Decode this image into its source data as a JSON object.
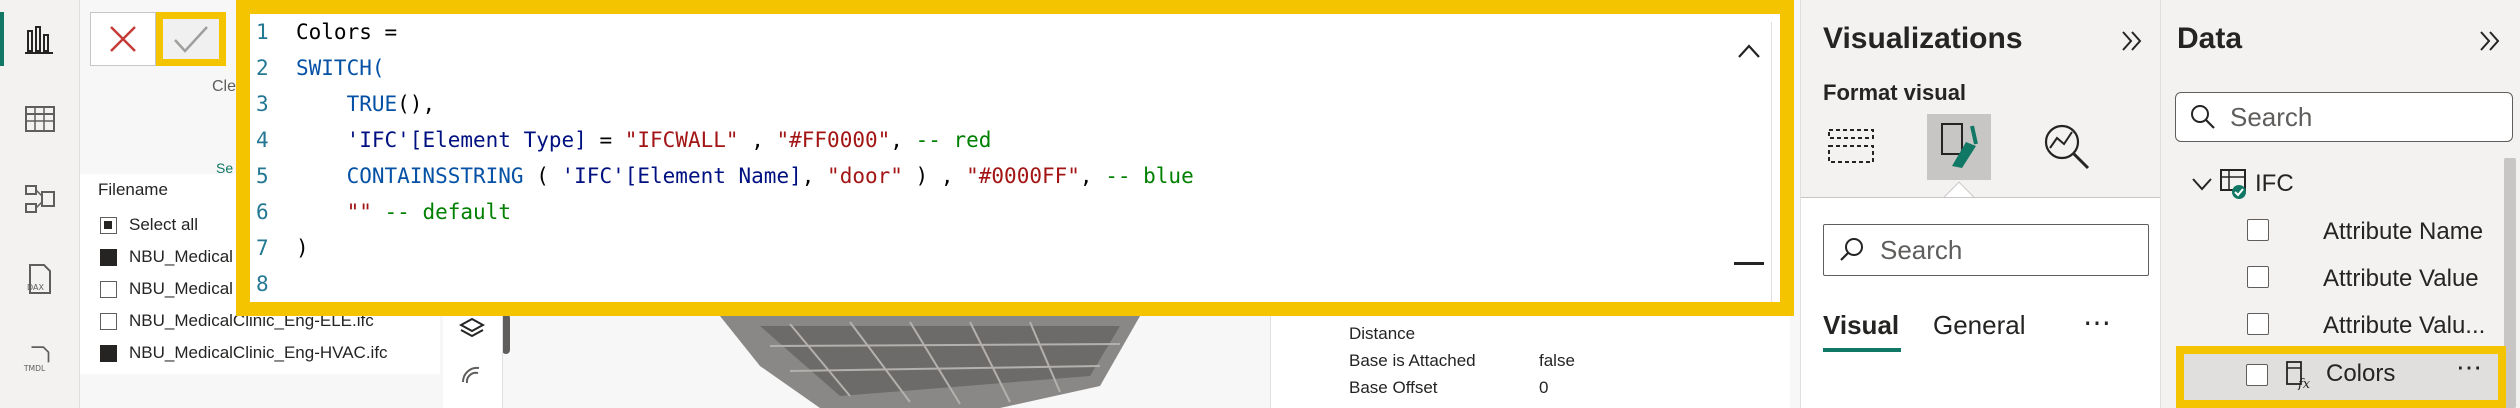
{
  "rail": {
    "items": [
      {
        "name": "report-view-icon",
        "active": true
      },
      {
        "name": "table-view-icon",
        "active": false
      },
      {
        "name": "model-view-icon",
        "active": false
      },
      {
        "name": "dax-query-view-icon",
        "label": "DAX",
        "active": false
      },
      {
        "name": "tmdl-view-icon",
        "label": "TMDL",
        "active": false
      }
    ]
  },
  "background": {
    "cle_fragment": "Cle",
    "se_fragment": "Se"
  },
  "slicer": {
    "title": "Filename",
    "items": [
      {
        "label": "Select all",
        "state": "partial"
      },
      {
        "label": "NBU_Medical",
        "state": "checked"
      },
      {
        "label": "NBU_Medical",
        "state": "unchecked"
      },
      {
        "label": "NBU_MedicalClinic_Eng-ELE.ifc",
        "state": "unchecked"
      },
      {
        "label": "NBU_MedicalClinic_Eng-HVAC.ifc",
        "state": "checked"
      }
    ]
  },
  "properties": [
    {
      "name": "Distance",
      "value": ""
    },
    {
      "name": "Base is Attached",
      "value": "false"
    },
    {
      "name": "Base Offset",
      "value": "0"
    }
  ],
  "editor": {
    "line_numbers": [
      "1",
      "2",
      "3",
      "4",
      "5",
      "6",
      "7",
      "8"
    ],
    "lines": [
      [
        {
          "t": "Colors =",
          "c": "txt"
        }
      ],
      [
        {
          "t": "SWITCH(",
          "c": "kw"
        }
      ],
      [
        {
          "t": "    TRUE",
          "c": "kw"
        },
        {
          "t": "(),",
          "c": "txt"
        }
      ],
      [
        {
          "t": "    ",
          "c": "txt"
        },
        {
          "t": "'IFC'",
          "c": "col"
        },
        {
          "t": "[Element Type]",
          "c": "col"
        },
        {
          "t": " = ",
          "c": "txt"
        },
        {
          "t": "\"IFCWALL\"",
          "c": "str"
        },
        {
          "t": " , ",
          "c": "txt"
        },
        {
          "t": "\"#FF0000\"",
          "c": "str"
        },
        {
          "t": ", ",
          "c": "txt"
        },
        {
          "t": "-- red",
          "c": "cmt"
        }
      ],
      [
        {
          "t": "    CONTAINSSTRING",
          "c": "kw"
        },
        {
          "t": " ( ",
          "c": "txt"
        },
        {
          "t": "'IFC'",
          "c": "col"
        },
        {
          "t": "[Element Name]",
          "c": "col"
        },
        {
          "t": ", ",
          "c": "txt"
        },
        {
          "t": "\"door\"",
          "c": "str"
        },
        {
          "t": " ) , ",
          "c": "txt"
        },
        {
          "t": "\"#0000FF\"",
          "c": "str"
        },
        {
          "t": ", ",
          "c": "txt"
        },
        {
          "t": "-- blue",
          "c": "cmt"
        }
      ],
      [
        {
          "t": "    ",
          "c": "txt"
        },
        {
          "t": "\"\"",
          "c": "str"
        },
        {
          "t": " ",
          "c": "txt"
        },
        {
          "t": "-- default",
          "c": "cmt"
        }
      ],
      [
        {
          "t": ")",
          "c": "txt"
        }
      ],
      [
        {
          "t": "",
          "c": "txt"
        }
      ]
    ]
  },
  "visualizations": {
    "title": "Visualizations",
    "format_visual_label": "Format visual",
    "search_placeholder": "Search",
    "tabs": [
      "Visual",
      "General"
    ],
    "more": "⋯"
  },
  "data_pane": {
    "title": "Data",
    "search_placeholder": "Search",
    "table_name": "IFC",
    "fields": [
      "Attribute Name",
      "Attribute Value",
      "Attribute Valu...",
      "Colors"
    ],
    "more": "⋯"
  },
  "colors": {
    "accent": "#117865",
    "highlight": "#f4c400",
    "close_red": "#c43c39"
  }
}
